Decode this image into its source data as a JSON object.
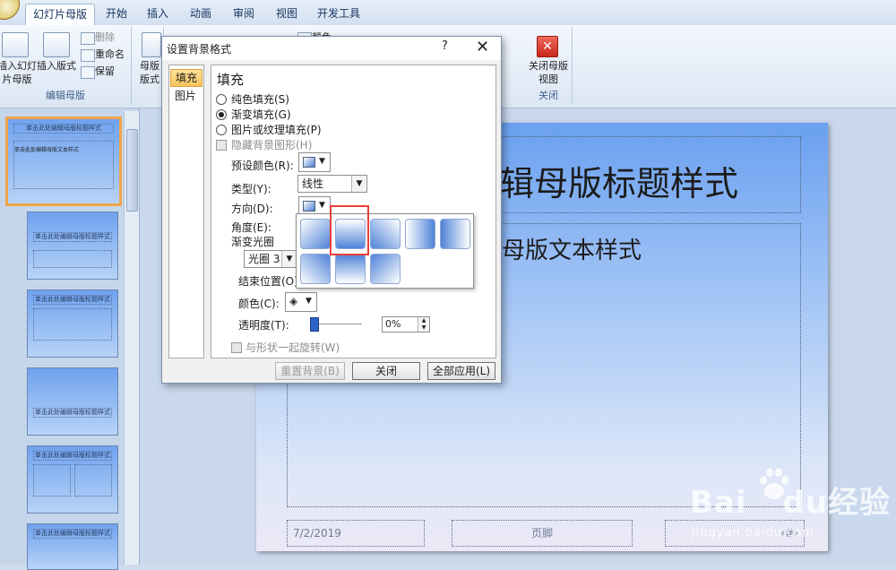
{
  "ribbon_tabs": [
    "幻灯片母版",
    "开始",
    "插入",
    "动画",
    "审阅",
    "视图",
    "开发工具"
  ],
  "ribbon": {
    "insert_slide_master": "插入幻灯片母版",
    "insert_layout": "插入版式",
    "delete": "删除",
    "rename": "重命名",
    "preserve": "保留",
    "group_edit_master": "编辑母版",
    "master_layout": "母版版式",
    "colors": "颜色",
    "close_master_view": "关闭母版视图",
    "group_close": "关闭"
  },
  "dialog": {
    "title": "设置背景格式",
    "help": "?",
    "close": "✕",
    "nav": [
      "填充",
      "图片"
    ],
    "section_title": "填充",
    "options": {
      "solid_fill": "纯色填充(S)",
      "gradient_fill": "渐变填充(G)",
      "picture_fill": "图片或纹理填充(P)",
      "hide_bg_graphics": "隐藏背景图形(H)"
    },
    "selected_fill": "gradient",
    "preset_colors_label": "预设颜色(R):",
    "type_label": "类型(Y):",
    "type_value": "线性",
    "direction_label": "方向(D):",
    "angle_label": "角度(E):",
    "gradient_stops_label": "渐变光圈",
    "stop_value": "光圈 3",
    "end_position_label": "结束位置(O):",
    "color_label": "颜色(C):",
    "transparency_label": "透明度(T):",
    "transparency_value": "0%",
    "transparency_level": 0,
    "rotate_with_shape": "与形状一起旋转(W)",
    "buttons": {
      "reset": "重置背景(B)",
      "close": "关闭",
      "apply_all": "全部应用(L)"
    }
  },
  "direction_popup": {
    "tiles": 8,
    "highlighted_index": 1,
    "highlight_color": "#e8403a"
  },
  "slide": {
    "title_text": "辑母版标题样式",
    "body_text": "母版文本样式",
    "date": "7/2/2019",
    "footer": "页脚",
    "page_number": "‹#›"
  },
  "thumbnails": {
    "master_title": "单击此处编辑母版标题样式",
    "master_body": "单击此处编辑母版文本样式",
    "count_visible": 6
  },
  "watermark": {
    "brand": "Bai",
    "brand2": "du",
    "cn": "经验",
    "url": "jingyan.baidu.com"
  },
  "colors": {
    "accent": "#f3a34a",
    "slide_top": "#6aa0f0",
    "highlight": "#e8403a"
  }
}
